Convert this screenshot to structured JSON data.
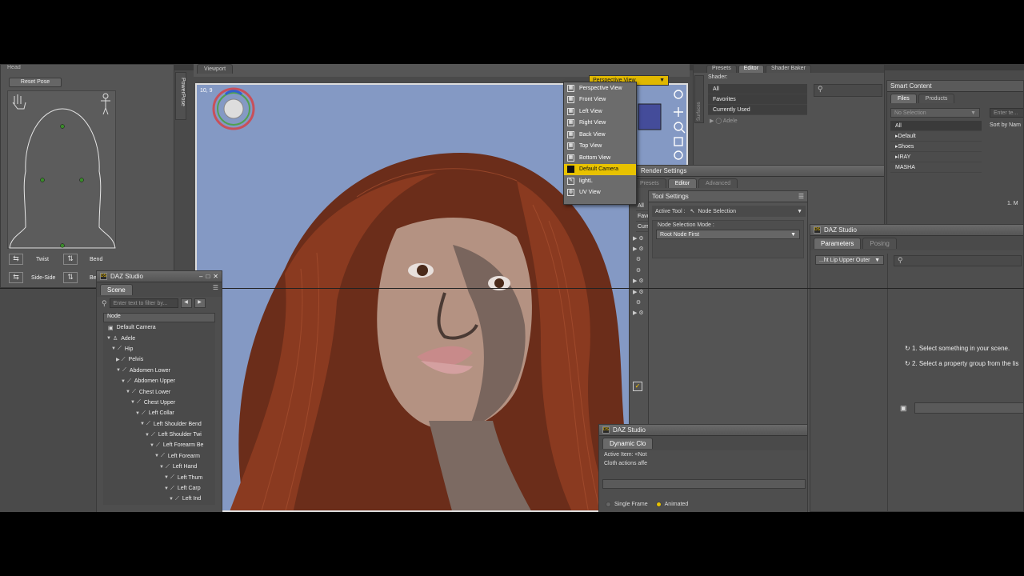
{
  "powerpose": {
    "tab_label": "PowerPose",
    "header_label": "Head",
    "reset_button": "Reset Pose",
    "twist_label": "Twist",
    "bend_label": "Bend",
    "side_side_label": "Side-Side",
    "bend2_label": "Be"
  },
  "viewport": {
    "tab_label": "Viewport",
    "fov_readout": "10, 9",
    "view_dropdown": "Perspective View"
  },
  "view_menu": {
    "items": [
      {
        "label": "Perspective View",
        "icon": "grid-icon"
      },
      {
        "label": "Front View",
        "icon": "grid-icon"
      },
      {
        "label": "Left View",
        "icon": "grid-icon"
      },
      {
        "label": "Right View",
        "icon": "grid-icon"
      },
      {
        "label": "Back View",
        "icon": "grid-icon"
      },
      {
        "label": "Top View",
        "icon": "grid-icon"
      },
      {
        "label": "Bottom View",
        "icon": "grid-icon"
      },
      {
        "label": "Default Camera",
        "icon": "camera-icon",
        "selected": true
      },
      {
        "label": "lightL",
        "icon": "light-icon"
      },
      {
        "label": "UV View",
        "icon": "globe-icon"
      }
    ]
  },
  "surfaces": {
    "side_tab": "Surfaces",
    "tabs": [
      "Presets",
      "Editor",
      "Shader Baker"
    ],
    "shader_label": "Shader:",
    "list": [
      "All",
      "Favorites",
      "Currently Used"
    ],
    "tree_item": "Adele"
  },
  "smart_content": {
    "title": "Smart Content",
    "tabs": [
      "Files",
      "Products"
    ],
    "dropdown": "No Selection",
    "search_placeholder": "Enter te...",
    "sort_label": "Sort by Nam",
    "categories": [
      "All",
      "Default",
      "Shoes",
      "IRAY",
      "MASHA"
    ],
    "side_hint": "1. M"
  },
  "render_settings": {
    "title": "Render Settings",
    "tabs": [
      "Presets",
      "Editor",
      "Advanced"
    ],
    "left_strip": [
      "All",
      "Favo",
      "Curr"
    ]
  },
  "tool_settings": {
    "title": "Tool Settings",
    "active_tool_label": "Active Tool :",
    "active_tool_value": "Node Selection",
    "mode_label": "Node Selection Mode :",
    "mode_value": "Root Node First"
  },
  "parameters": {
    "window_title": "DAZ Studio",
    "tabs": [
      "Parameters",
      "Posing"
    ],
    "property_dropdown": "...ht Lip Upper Outer",
    "hint1": "1. Select something in your scene.",
    "hint2": "2. Select a property group from the lis"
  },
  "scene": {
    "window_title": "DAZ Studio",
    "tab_label": "Scene",
    "filter_placeholder": "Enter text to filter by...",
    "column_header": "Node",
    "nodes": [
      {
        "label": "Default Camera",
        "indent": 0,
        "icon": "camera-icon",
        "arrow": ""
      },
      {
        "label": "Adele",
        "indent": 0,
        "icon": "figure-icon",
        "arrow": "▼"
      },
      {
        "label": "Hip",
        "indent": 1,
        "icon": "bone-icon",
        "arrow": "▼"
      },
      {
        "label": "Pelvis",
        "indent": 2,
        "icon": "bone-icon",
        "arrow": "▶"
      },
      {
        "label": "Abdomen Lower",
        "indent": 2,
        "icon": "bone-icon",
        "arrow": "▼"
      },
      {
        "label": "Abdomen Upper",
        "indent": 3,
        "icon": "bone-icon",
        "arrow": "▼"
      },
      {
        "label": "Chest Lower",
        "indent": 4,
        "icon": "bone-icon",
        "arrow": "▼"
      },
      {
        "label": "Chest Upper",
        "indent": 5,
        "icon": "bone-icon",
        "arrow": "▼"
      },
      {
        "label": "Left Collar",
        "indent": 6,
        "icon": "bone-icon",
        "arrow": "▼"
      },
      {
        "label": "Left Shoulder Bend",
        "indent": 7,
        "icon": "bone-icon",
        "arrow": "▼"
      },
      {
        "label": "Left Shoulder Twi",
        "indent": 8,
        "icon": "bone-icon",
        "arrow": "▼"
      },
      {
        "label": "Left Forearm Be",
        "indent": 9,
        "icon": "bone-icon",
        "arrow": "▼"
      },
      {
        "label": "Left Forearm",
        "indent": 10,
        "icon": "bone-icon",
        "arrow": "▼"
      },
      {
        "label": "Left Hand",
        "indent": 11,
        "icon": "bone-icon",
        "arrow": "▼"
      },
      {
        "label": "Left Thum",
        "indent": 12,
        "icon": "bone-icon",
        "arrow": "▼"
      },
      {
        "label": "Left Carp",
        "indent": 12,
        "icon": "bone-icon",
        "arrow": "▼"
      },
      {
        "label": "Left Ind",
        "indent": 13,
        "icon": "bone-icon",
        "arrow": "▼"
      }
    ]
  },
  "dynamic_cloth": {
    "window_title": "DAZ Studio",
    "tab_label": "Dynamic Clo",
    "active_item": "Active Item: <Not",
    "actions_text": "Cloth actions affe",
    "single_frame": "Single Frame",
    "animated": "Animated"
  },
  "colors": {
    "viewport_bg": "#8499c4",
    "accent": "#e8c200",
    "panel": "#5a5a5a"
  }
}
